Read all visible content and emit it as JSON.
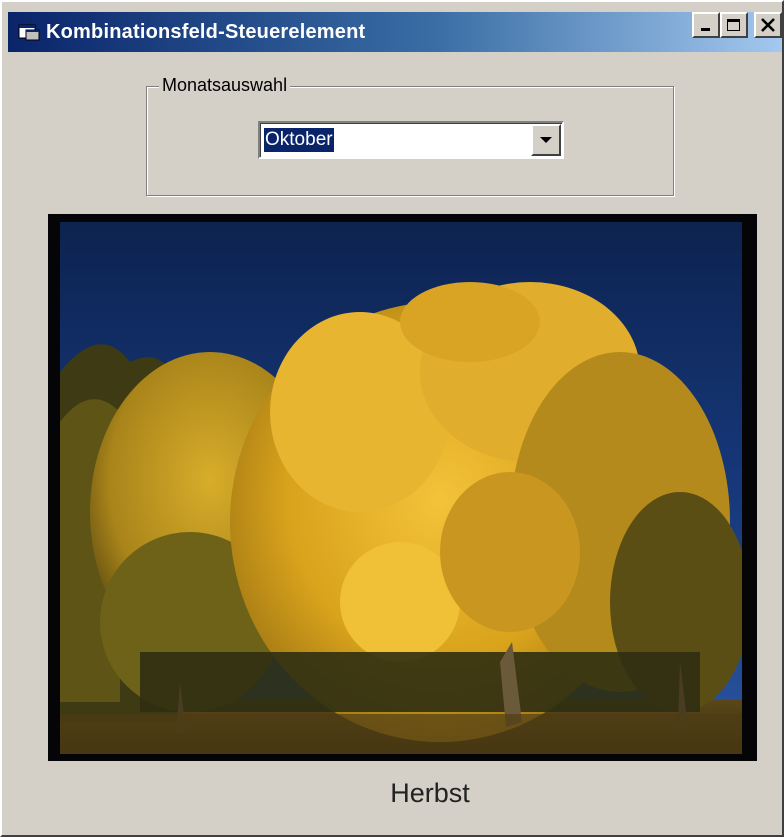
{
  "window": {
    "title": "Kombinationsfeld-Steuerelement",
    "title_icon": "app-window-icon",
    "buttons": {
      "minimize_icon": "minimize-icon",
      "maximize_icon": "maximize-icon",
      "close_icon": "close-icon"
    }
  },
  "month_group": {
    "legend": "Monatsauswahl",
    "combo": {
      "selected_value": "Oktober",
      "dropdown_icon": "chevron-down-icon"
    }
  },
  "picture": {
    "description_icon": "autumn-tree-photo"
  },
  "season_label": "Herbst",
  "colors": {
    "title_gradient_start": "#0a246a",
    "title_gradient_end": "#a6caf0",
    "face": "#d4d0c8",
    "selection": "#0a246a"
  }
}
